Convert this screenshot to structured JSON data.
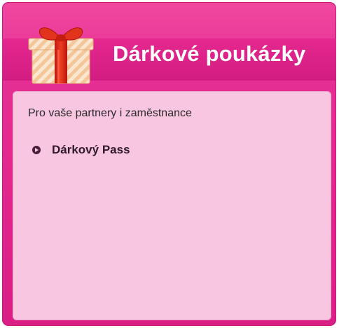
{
  "widget": {
    "title": "Dárkové poukázky",
    "subtitle": "Pro vaše partnery i zaměstnance",
    "links": [
      {
        "label": "Dárkový Pass",
        "icon": "arrow-bullet-icon"
      }
    ],
    "header_icon": "gift-icon",
    "colors": {
      "frame": "#e62f95",
      "content_background": "#f9c6e2",
      "title_text": "#ffffff",
      "link_text": "#2e1a28"
    }
  }
}
